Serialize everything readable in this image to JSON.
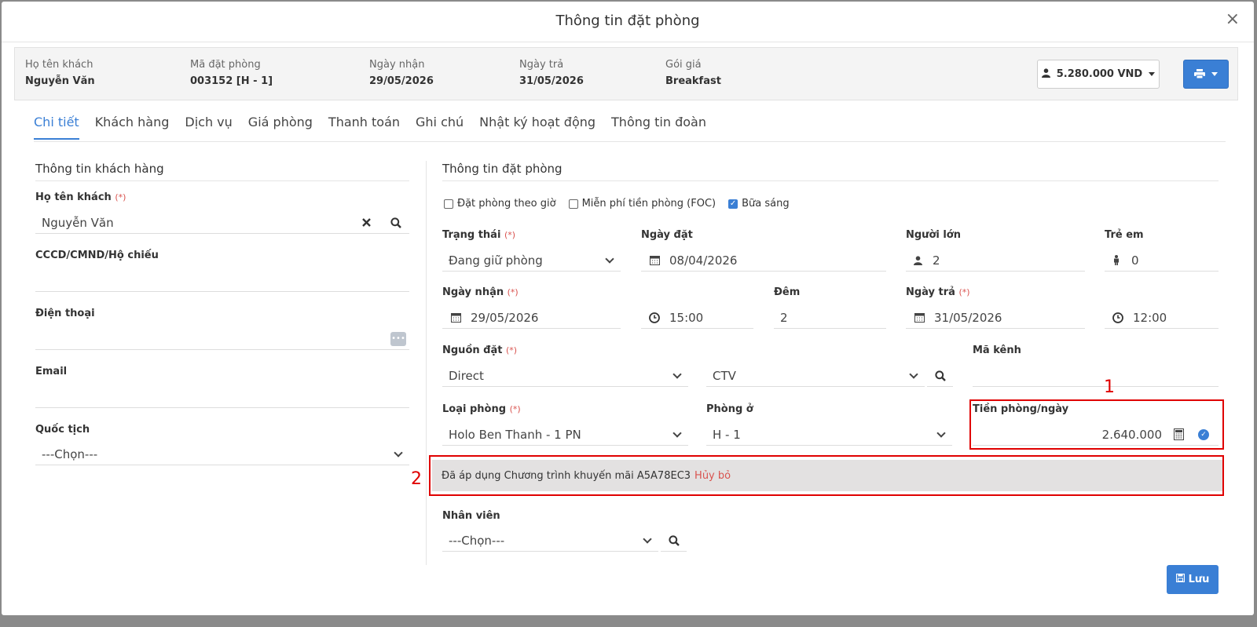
{
  "modal": {
    "title": "Thông tin đặt phòng",
    "close": "×"
  },
  "summary": {
    "guest_label": "Họ tên khách",
    "guest_value": "Nguyễn Văn",
    "code_label": "Mã đặt phòng",
    "code_value": "003152 [H - 1]",
    "checkin_label": "Ngày nhận",
    "checkin_value": "29/05/2026",
    "checkout_label": "Ngày trả",
    "checkout_value": "31/05/2026",
    "rate_label": "Gói giá",
    "rate_value": "Breakfast",
    "total": "5.280.000 VND"
  },
  "tabs": [
    "Chi tiết",
    "Khách hàng",
    "Dịch vụ",
    "Giá phòng",
    "Thanh toán",
    "Ghi chú",
    "Nhật ký hoạt động",
    "Thông tin đoàn"
  ],
  "customer": {
    "section_title": "Thông tin khách hàng",
    "name_label": "Họ tên khách",
    "name_value": "Nguyễn Văn",
    "id_label": "CCCD/CMND/Hộ chiếu",
    "id_value": "",
    "phone_label": "Điện thoại",
    "phone_value": "",
    "email_label": "Email",
    "email_value": "",
    "nationality_label": "Quốc tịch",
    "nationality_value": "---Chọn---"
  },
  "required_mark": "(*)",
  "booking": {
    "section_title": "Thông tin đặt phòng",
    "hourly_label": "Đặt phòng theo giờ",
    "foc_label": "Miễn phí tiền phòng (FOC)",
    "breakfast_label": "Bữa sáng",
    "status_label": "Trạng thái",
    "status_value": "Đang giữ phòng",
    "booked_date_label": "Ngày đặt",
    "booked_date_value": "08/04/2026",
    "adults_label": "Người lớn",
    "adults_value": "2",
    "children_label": "Trẻ em",
    "children_value": "0",
    "checkin_label": "Ngày nhận",
    "checkin_date": "29/05/2026",
    "checkin_time": "15:00",
    "nights_label": "Đêm",
    "nights_value": "2",
    "checkout_label": "Ngày trả",
    "checkout_date": "31/05/2026",
    "checkout_time": "12:00",
    "source_label": "Nguồn đặt",
    "source_value": "Direct",
    "sub_source_value": "CTV",
    "channel_code_label": "Mã kênh",
    "channel_code_value": "",
    "room_type_label": "Loại phòng",
    "room_type_value": "Holo Ben Thanh - 1 PN",
    "room_label": "Phòng ở",
    "room_value": "H - 1",
    "rate_label": "Tiền phòng/ngày",
    "rate_value": "2.640.000",
    "promo_text": "Đã áp dụng Chương trình khuyến mãi A5A78EC3",
    "promo_cancel": "Hủy bỏ",
    "staff_label": "Nhân viên",
    "staff_value": "---Chọn---"
  },
  "annotations": {
    "one": "1",
    "two": "2"
  },
  "save_label": "Lưu"
}
